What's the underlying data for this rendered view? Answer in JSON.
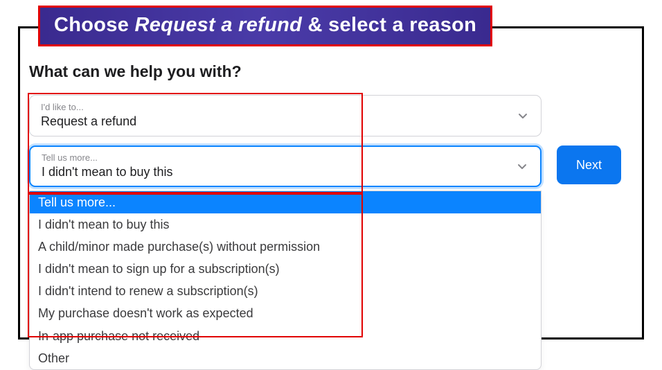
{
  "banner": {
    "pre": "Choose ",
    "italic": "Request a refund",
    "post": " & select a reason"
  },
  "heading": "What can we help you with?",
  "select1": {
    "label": "I'd like to...",
    "value": "Request a refund"
  },
  "select2": {
    "label": "Tell us more...",
    "value": "I didn't mean to buy this"
  },
  "next_label": "Next",
  "dropdown": {
    "placeholder": "Tell us more...",
    "options": [
      "I didn't mean to buy this",
      "A child/minor made purchase(s) without permission",
      "I didn't mean to sign up for a subscription(s)",
      "I didn't intend to renew a subscription(s)",
      "My purchase doesn't work as expected",
      "In-app purchase not received",
      "Other"
    ]
  },
  "colors": {
    "accent": "#0b84ff",
    "banner_border": "#e10000",
    "banner_bg": "#3a2a8f"
  }
}
